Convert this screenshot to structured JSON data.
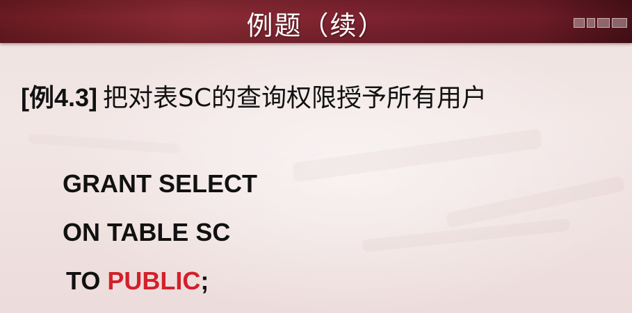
{
  "slide": {
    "title": "例题（续）",
    "example": {
      "tag": "[例4.3]",
      "description": "把对表SC的查询权限授予所有用户"
    },
    "code": {
      "line1": "GRANT SELECT",
      "line2": "ON TABLE SC",
      "line3_prefix": "TO ",
      "line3_keyword": "PUBLIC",
      "line3_suffix": ";"
    }
  },
  "colors": {
    "title_bar": "#7d2230",
    "title_text": "#ffffff",
    "body_text": "#111111",
    "highlight": "#d3202a"
  }
}
